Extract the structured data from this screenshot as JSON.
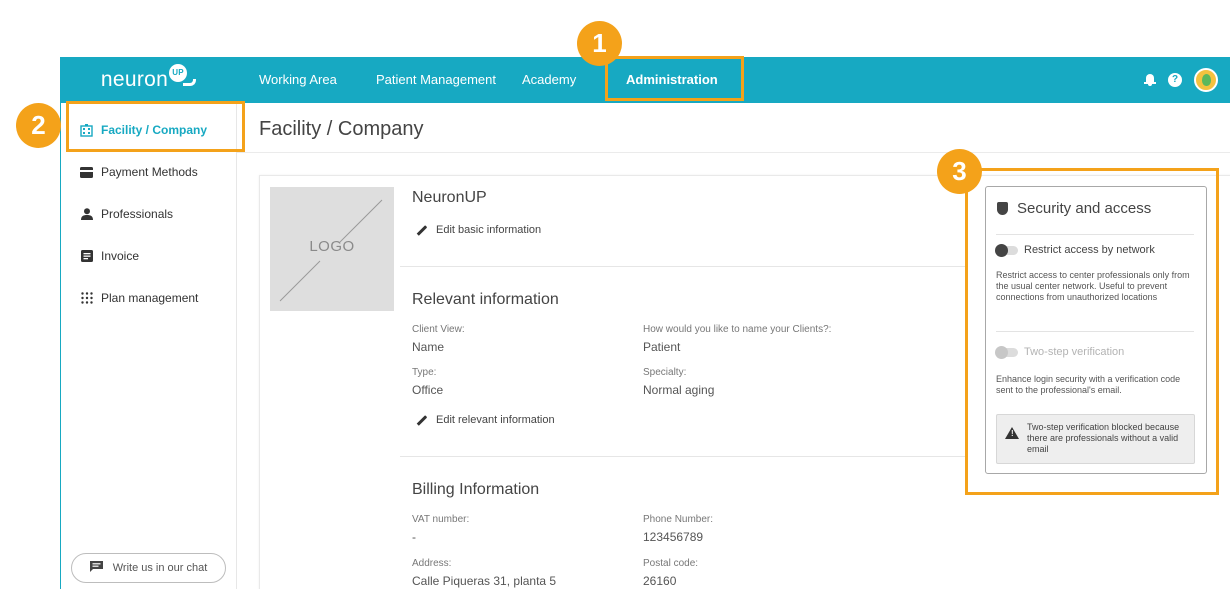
{
  "brand": {
    "logo_text": "neuron",
    "logo_badge": "UP"
  },
  "topnav": {
    "items": [
      {
        "label": "Working Area"
      },
      {
        "label": "Patient Management"
      },
      {
        "label": "Academy"
      },
      {
        "label": "Administration",
        "active": true
      }
    ],
    "icons": [
      "bell-icon",
      "help-icon",
      "avatar"
    ],
    "help_glyph": "?"
  },
  "sidebar": {
    "items": [
      {
        "label": "Facility / Company",
        "icon": "building-icon",
        "active": true
      },
      {
        "label": "Payment Methods",
        "icon": "credit-card-icon"
      },
      {
        "label": "Professionals",
        "icon": "person-icon"
      },
      {
        "label": "Invoice",
        "icon": "document-icon"
      },
      {
        "label": "Plan management",
        "icon": "grid-icon"
      }
    ],
    "chat_button": "Write us in our chat"
  },
  "page": {
    "title": "Facility / Company"
  },
  "company": {
    "logo_placeholder": "LOGO",
    "name": "NeuronUP",
    "edit_basic": "Edit basic information"
  },
  "relevant": {
    "title": "Relevant information",
    "client_view_label": "Client View:",
    "client_view_value": "Name",
    "name_clients_label": "How would you like to name your Clients?:",
    "name_clients_value": "Patient",
    "type_label": "Type:",
    "type_value": "Office",
    "specialty_label": "Specialty:",
    "specialty_value": "Normal aging",
    "edit_relevant": "Edit relevant information"
  },
  "billing": {
    "title": "Billing Information",
    "vat_label": "VAT number:",
    "vat_value": "-",
    "phone_label": "Phone Number:",
    "phone_value": "123456789",
    "address_label": "Address:",
    "address_value": "Calle Piqueras 31, planta 5",
    "postal_label": "Postal code:",
    "postal_value": "26160"
  },
  "security": {
    "title": "Security and access",
    "restrict_label": "Restrict access by network",
    "restrict_enabled": false,
    "restrict_desc": "Restrict access to center professionals only from the usual center network. Useful to prevent connections from unauthorized locations",
    "twostep_label": "Two-step verification",
    "twostep_enabled": false,
    "twostep_disabled": true,
    "twostep_desc": "Enhance login security with a verification code sent to the professional's email.",
    "warning": "Two-step verification blocked because there are professionals without a valid email"
  },
  "callouts": [
    "1",
    "2",
    "3"
  ],
  "colors": {
    "brand": "#17a9c2",
    "callout": "#f4a21a"
  }
}
